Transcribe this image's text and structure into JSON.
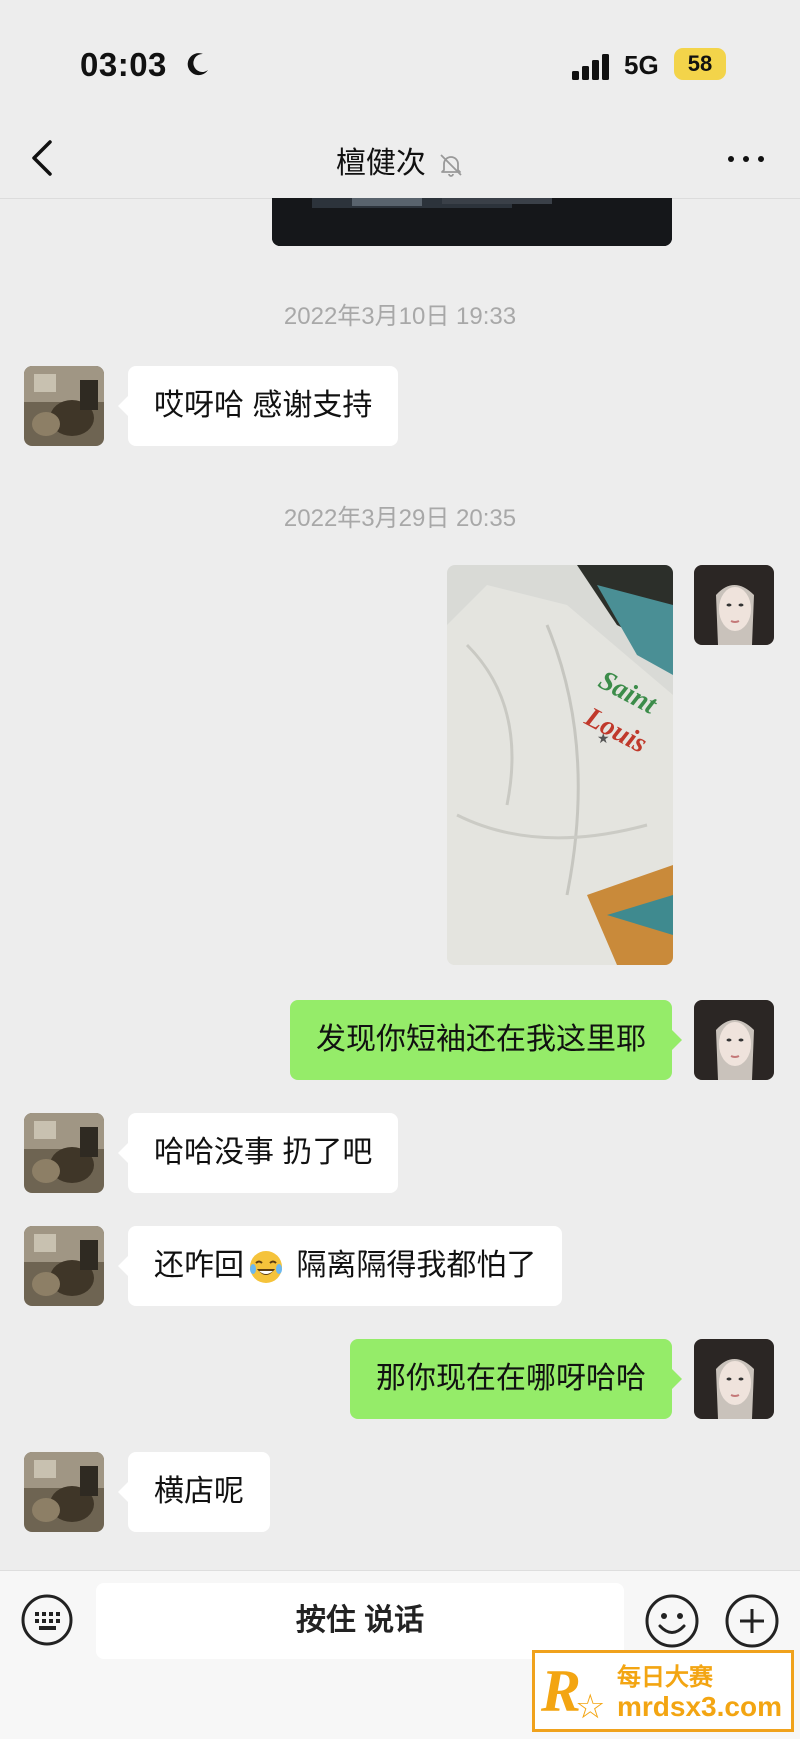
{
  "status_bar": {
    "time": "03:03",
    "network": "5G",
    "battery": "58"
  },
  "nav": {
    "title": "檀健次"
  },
  "timestamps": [
    "2022年3月10日 19:33",
    "2022年3月29日 20:35"
  ],
  "messages": [
    {
      "side": "left",
      "text": "哎呀哈 感谢支持"
    },
    {
      "side": "right",
      "type": "image"
    },
    {
      "side": "right",
      "text": "发现你短袖还在我这里耶"
    },
    {
      "side": "left",
      "text": "哈哈没事 扔了吧"
    },
    {
      "side": "left",
      "text_before": "还咋回",
      "emoji": "laughing-tears-emoji",
      "text_after": " 隔离隔得我都怕了"
    },
    {
      "side": "right",
      "text": "那你现在在哪呀哈哈"
    },
    {
      "side": "left",
      "text": "横店呢"
    }
  ],
  "photo": {
    "shirt_text_line1": "Saint",
    "shirt_text_line2": "Louis"
  },
  "input_bar": {
    "hold_to_talk": "按住 说话"
  },
  "watermark": {
    "letter": "R",
    "title": "每日大赛",
    "url": "mrdsx3.com"
  },
  "colors": {
    "background": "#ededed",
    "bubble_self": "#95ec69",
    "bubble_other": "#ffffff",
    "timestamp": "#a8a8a8",
    "battery": "#f3d44a",
    "watermark": "#f3a512"
  }
}
